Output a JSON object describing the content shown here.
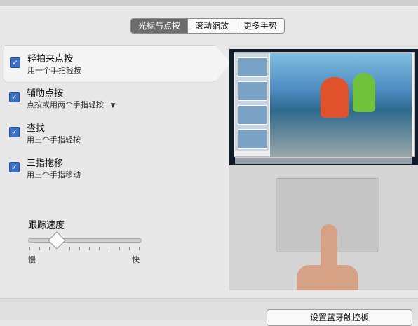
{
  "tabs": [
    {
      "label": "光标与点按",
      "active": true
    },
    {
      "label": "滚动缩放",
      "active": false
    },
    {
      "label": "更多手势",
      "active": false
    }
  ],
  "options": [
    {
      "title": "轻拍来点按",
      "subtitle": "用一个手指轻按",
      "checked": true
    },
    {
      "title": "辅助点按",
      "subtitle": "点按或用两个手指轻按",
      "checked": true,
      "has_dropdown": true
    },
    {
      "title": "查找",
      "subtitle": "用三个手指轻按",
      "checked": true
    },
    {
      "title": "三指拖移",
      "subtitle": "用三个手指移动",
      "checked": true
    }
  ],
  "tracking": {
    "title": "跟踪速度",
    "slow_label": "慢",
    "fast_label": "快",
    "value_fraction": 0.25
  },
  "preview": {
    "description_icon": "trackpad-demo-image"
  },
  "footer": {
    "bluetooth_button": "设置蓝牙触控板"
  },
  "colors": {
    "accent": "#3b72c7",
    "active_tab": "#6c6c6c"
  }
}
